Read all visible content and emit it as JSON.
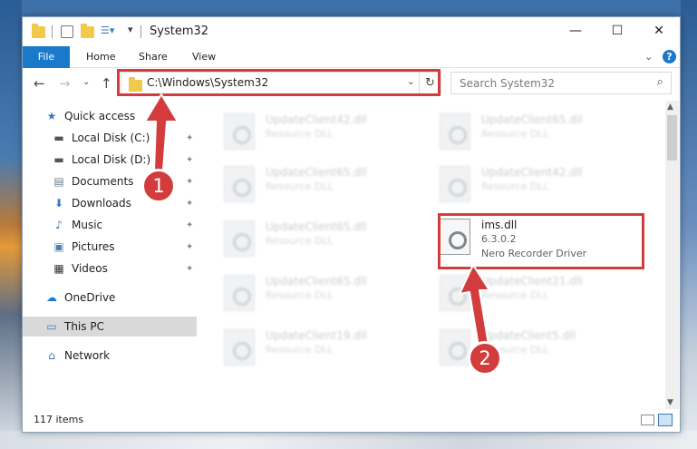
{
  "window": {
    "title": "System32",
    "controls": {
      "minimize": "—",
      "maximize": "☐",
      "close": "✕"
    }
  },
  "ribbon": {
    "file_tab": "File",
    "tabs": [
      "Home",
      "Share",
      "View"
    ],
    "expand_glyph": "⌄",
    "help_glyph": "?"
  },
  "nav": {
    "address": "C:\\Windows\\System32",
    "search_placeholder": "Search System32"
  },
  "sidebar": {
    "items": [
      {
        "label": "Quick access",
        "icon": "star-icon",
        "glyph": "★",
        "pinned": false
      },
      {
        "label": "Local Disk (C:)",
        "icon": "drive-icon",
        "glyph": "▬",
        "pinned": true
      },
      {
        "label": "Local Disk (D:)",
        "icon": "drive-icon",
        "glyph": "▬",
        "pinned": true
      },
      {
        "label": "Documents",
        "icon": "documents-icon",
        "glyph": "▤",
        "pinned": true
      },
      {
        "label": "Downloads",
        "icon": "download-icon",
        "glyph": "⬇",
        "pinned": true
      },
      {
        "label": "Music",
        "icon": "music-icon",
        "glyph": "♪",
        "pinned": true
      },
      {
        "label": "Pictures",
        "icon": "pictures-icon",
        "glyph": "▣",
        "pinned": true
      },
      {
        "label": "Videos",
        "icon": "videos-icon",
        "glyph": "▦",
        "pinned": true
      },
      {
        "label": "OneDrive",
        "icon": "cloud-icon",
        "glyph": "☁",
        "pinned": false
      },
      {
        "label": "This PC",
        "icon": "computer-icon",
        "glyph": "▭",
        "pinned": false,
        "selected": true
      },
      {
        "label": "Network",
        "icon": "network-icon",
        "glyph": "⌂",
        "pinned": false
      }
    ]
  },
  "files": [
    {
      "name": "UpdateClient42.dll",
      "desc": "Resource DLL"
    },
    {
      "name": "UpdateClient65.dll",
      "desc": "Resource DLL"
    },
    {
      "name": "UpdateClient65.dll",
      "desc": "Resource DLL"
    },
    {
      "name": "UpdateClient42.dll",
      "desc": "Resource DLL"
    },
    {
      "name": "UpdateClient65.dll",
      "desc": "Resource DLL"
    },
    {
      "name": "ims.dll",
      "version": "6.3.0.2",
      "desc": "Nero Recorder Driver",
      "highlighted": true
    },
    {
      "name": "UpdateClient65.dll",
      "desc": "Resource DLL"
    },
    {
      "name": "UpdateClient21.dll",
      "desc": "Resource DLL"
    },
    {
      "name": "UpdateClient19.dll",
      "desc": "Resource DLL"
    },
    {
      "name": "UpdateClient5.dll",
      "desc": "Resource DLL"
    }
  ],
  "status": {
    "item_count": "117 items"
  },
  "annotations": {
    "step1": "1",
    "step2": "2",
    "color": "#d23c3c"
  }
}
